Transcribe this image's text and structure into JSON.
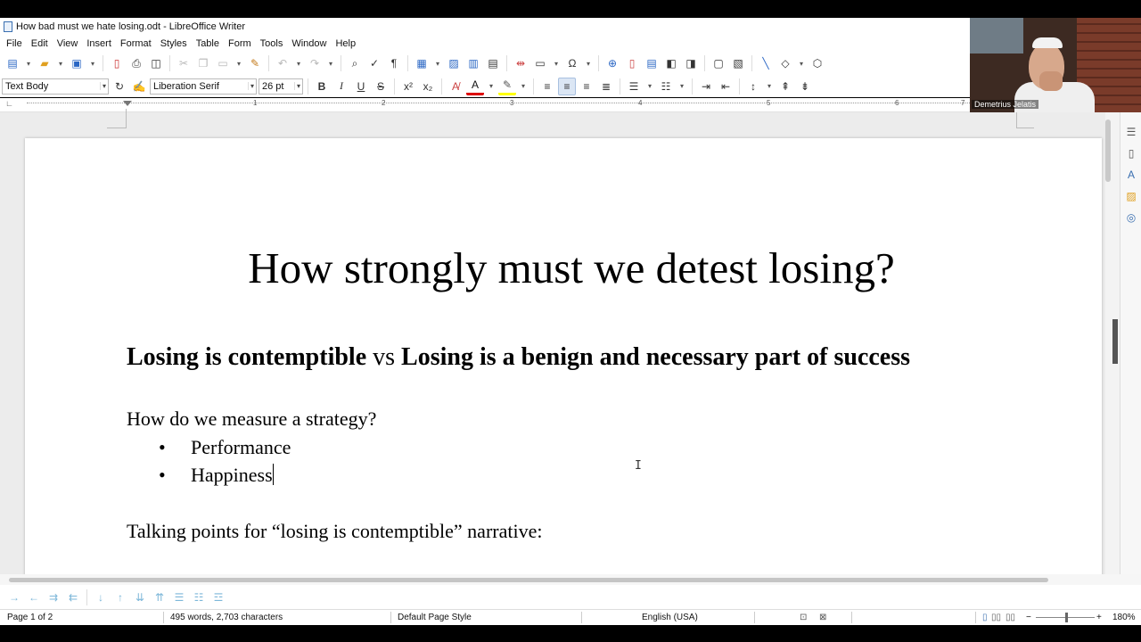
{
  "window": {
    "title": "How bad must we hate losing.odt - LibreOffice Writer"
  },
  "menu": [
    "File",
    "Edit",
    "View",
    "Insert",
    "Format",
    "Styles",
    "Table",
    "Form",
    "Tools",
    "Window",
    "Help"
  ],
  "formatting": {
    "paragraph_style": "Text Body",
    "font_name": "Liberation Serif",
    "font_size": "26 pt"
  },
  "ruler": {
    "numbers": [
      "1",
      "2",
      "3",
      "4",
      "5",
      "6",
      "7"
    ]
  },
  "document": {
    "title": "How strongly must we detest losing?",
    "subtitle": {
      "part1": "Losing is contemptible",
      "vs": " vs ",
      "part2": "Losing is a benign and necessary part of success"
    },
    "question": "How do we measure a strategy?",
    "bullets": [
      "Performance",
      "Happiness"
    ],
    "talking_points": "Talking points for “losing is contemptible” narrative:"
  },
  "status": {
    "page": "Page 1 of 2",
    "words": "495 words, 2,703 characters",
    "page_style": "Default Page Style",
    "language": "English (USA)",
    "zoom": "180%"
  },
  "webcam": {
    "name": "Demetrius Jelatis"
  }
}
